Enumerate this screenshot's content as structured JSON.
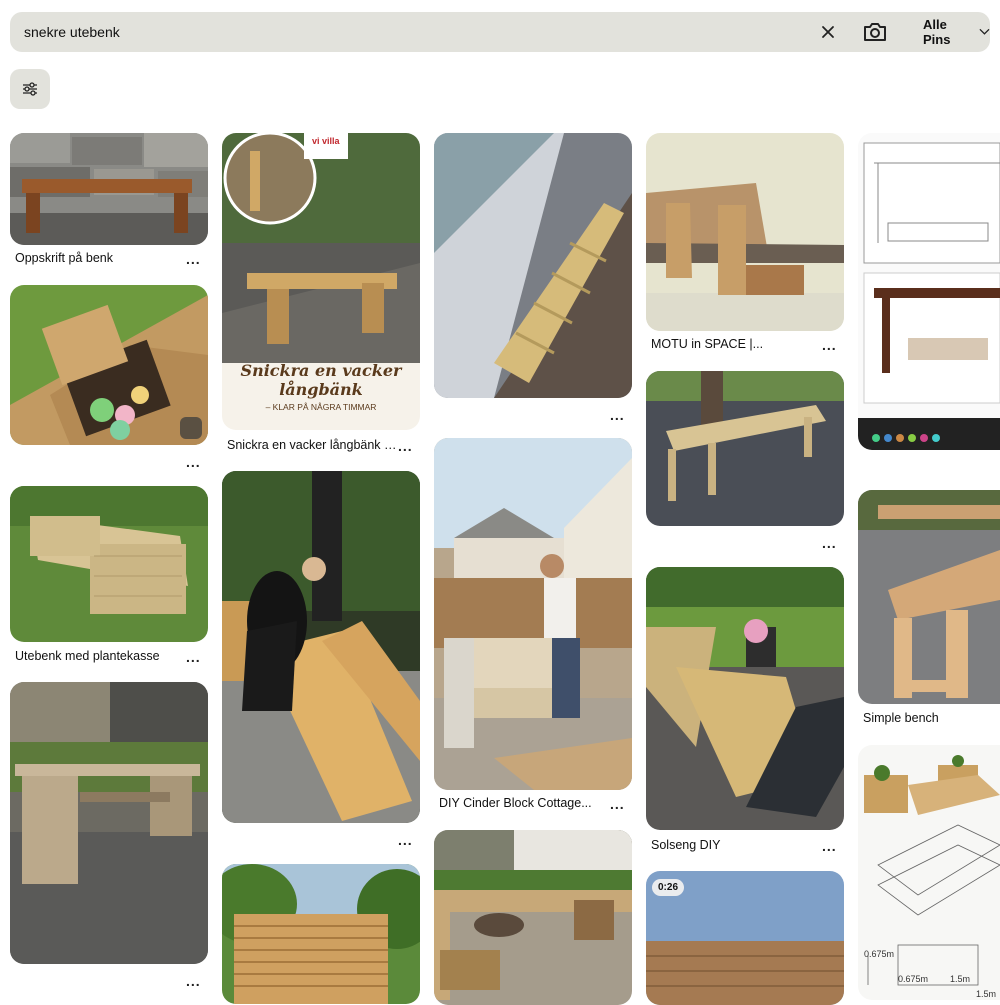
{
  "search": {
    "query": "snekre utebenk",
    "scope_label": "Alle Pins"
  },
  "pins": {
    "p1": {
      "title": "Oppskrift på benk"
    },
    "p2": {
      "title": ""
    },
    "p3": {
      "title": "Utebenk med plantekasse"
    },
    "p4": {
      "title": ""
    },
    "p5": {
      "title": "Snickra en vacker långbänk til...",
      "overlay_brand": "vi villa",
      "overlay_heading": "Snickra en vacker långbänk",
      "overlay_sub": "– KLAR PÅ NÅGRA TIMMAR"
    },
    "p6": {
      "title": ""
    },
    "p7": {
      "title": ""
    },
    "p8": {
      "title": ""
    },
    "p9": {
      "title": "DIY Cinder Block Cottage..."
    },
    "p10": {
      "title": ""
    },
    "p11": {
      "title": "MOTU in SPACE |..."
    },
    "p12": {
      "title": ""
    },
    "p13": {
      "title": "Solseng DIY"
    },
    "p14": {
      "title": "",
      "duration": "0:26"
    },
    "p15": {
      "title": ""
    },
    "p16": {
      "title": "Simple bench"
    },
    "p17": {
      "title": "",
      "dims": [
        "0.675m",
        "0.675m",
        "1.5m",
        "1.5m"
      ]
    }
  },
  "more_label": "...",
  "icons": {
    "clear": "close-icon",
    "camera": "camera-search-icon",
    "dropdown": "chevron-down-icon",
    "filters": "sliders-icon",
    "lens": "visual-search-icon"
  },
  "colors": {
    "search_bg": "#e2e2dc",
    "wood": "#c9a66b",
    "grass": "#5f8a3a"
  }
}
